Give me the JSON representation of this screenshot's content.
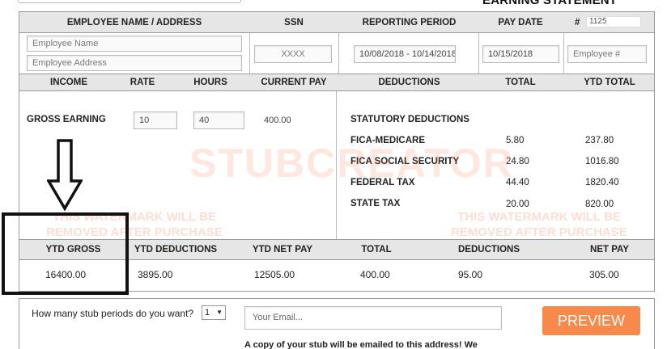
{
  "page_title": "EARNING STATEMENT",
  "header": {
    "name_address": "EMPLOYEE NAME / ADDRESS",
    "ssn": "SSN",
    "reporting_period": "REPORTING PERIOD",
    "pay_date": "PAY DATE",
    "number": "#",
    "number_value": "1125"
  },
  "employee": {
    "name_placeholder": "Employee Name",
    "address_placeholder": "Employee Address",
    "ssn_value": "XXXX",
    "reporting_period_value": "10/08/2018 - 10/14/2018",
    "pay_date_value": "10/15/2018",
    "employee_number_placeholder": "Employee #"
  },
  "income_header": {
    "income": "INCOME",
    "rate": "RATE",
    "hours": "HOURS",
    "current_pay": "CURRENT PAY",
    "deductions": "DEDUCTIONS",
    "total": "TOTAL",
    "ytd_total": "YTD TOTAL"
  },
  "income": {
    "label": "GROSS EARNING",
    "rate": "10",
    "hours": "40",
    "current_pay": "400.00"
  },
  "deductions": {
    "section_title": "STATUTORY DEDUCTIONS",
    "items": [
      {
        "label": "FICA-MEDICARE",
        "total": "5.80",
        "ytd": "237.80"
      },
      {
        "label": "FICA SOCIAL SECURITY",
        "total": "24.80",
        "ytd": "1016.80"
      },
      {
        "label": "FEDERAL TAX",
        "total": "44.40",
        "ytd": "1820.40"
      },
      {
        "label": "STATE TAX",
        "total": "20.00",
        "ytd": "820.00"
      }
    ]
  },
  "watermark": {
    "brand": "STUBCREATOR",
    "line1": "THIS WATERMARK WILL BE",
    "line2": "REMOVED AFTER PURCHASE"
  },
  "summary_header": {
    "ytd_gross": "YTD GROSS",
    "ytd_deductions": "YTD DEDUCTIONS",
    "ytd_net_pay": "YTD NET PAY",
    "total": "TOTAL",
    "deductions": "DEDUCTIONS",
    "net_pay": "NET PAY"
  },
  "summary": {
    "ytd_gross": "16400.00",
    "ytd_deductions": "3895.00",
    "ytd_net_pay": "12505.00",
    "total": "400.00",
    "deductions": "95.00",
    "net_pay": "305.00"
  },
  "order": {
    "stub_question": "How many stub periods do you want?",
    "stub_count": "1",
    "email_placeholder": "Your Email...",
    "preview_label": "PREVIEW",
    "note": "A copy of your stub will be emailed to this address! We"
  },
  "colors": {
    "accent": "#f7894b",
    "header_bg": "#e6e6e6"
  }
}
